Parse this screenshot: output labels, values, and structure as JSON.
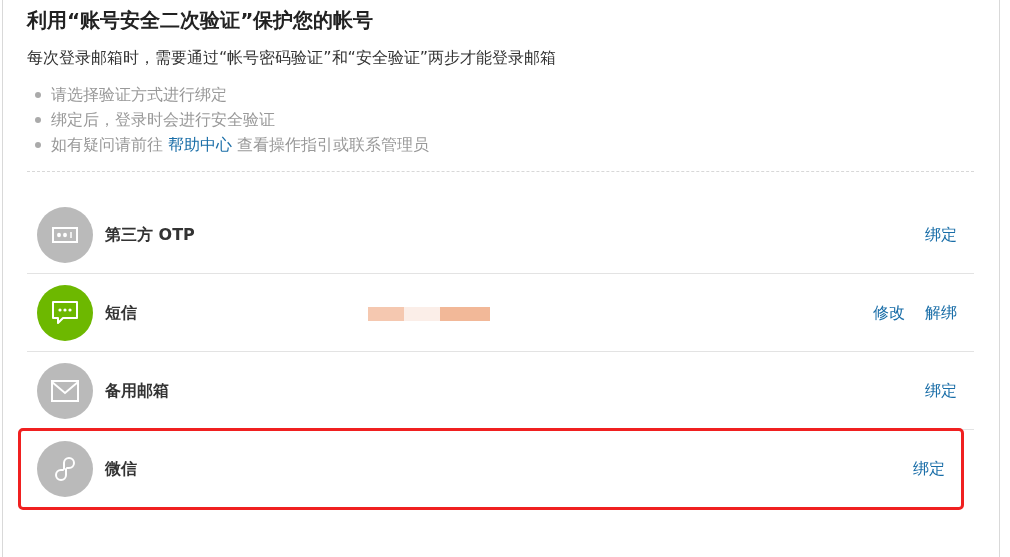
{
  "title": "利用“账号安全二次验证”保护您的帐号",
  "subtitle": "每次登录邮箱时，需要通过“帐号密码验证”和“安全验证”两步才能登录邮箱",
  "tips": [
    {
      "text": "请选择验证方式进行绑定"
    },
    {
      "text": "绑定后，登录时会进行安全验证"
    },
    {
      "text": "如有疑问请前往",
      "link": "帮助中心",
      "after": "查看操作指引或联系管理员"
    }
  ],
  "methods": [
    {
      "kind": "otp",
      "name": "第三方 OTP",
      "bound": false,
      "redacted_value": false,
      "highlighted": false,
      "actions": [
        "绑定"
      ]
    },
    {
      "kind": "sms",
      "name": "短信",
      "bound": true,
      "redacted_value": true,
      "highlighted": false,
      "actions": [
        "修改",
        "解绑"
      ]
    },
    {
      "kind": "email",
      "name": "备用邮箱",
      "bound": false,
      "redacted_value": false,
      "highlighted": false,
      "actions": [
        "绑定"
      ]
    },
    {
      "kind": "wechat",
      "name": "微信",
      "bound": false,
      "redacted_value": false,
      "highlighted": true,
      "actions": [
        "绑定"
      ]
    }
  ]
}
